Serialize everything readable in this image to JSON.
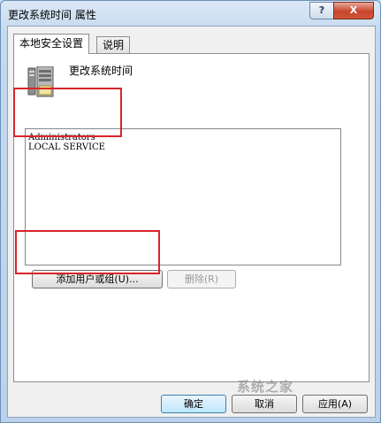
{
  "window": {
    "title": "更改系统时间 属性",
    "help_label": "?",
    "close_label": "X"
  },
  "tabs": [
    {
      "label": "本地安全设置",
      "active": true
    },
    {
      "label": "说明",
      "active": false
    }
  ],
  "policy": {
    "name": "更改系统时间",
    "icon": "server-computer-icon"
  },
  "members": [
    "Administrators",
    "LOCAL SERVICE"
  ],
  "buttons": {
    "add_label": "添加用户或组(U)...",
    "remove_label": "删除(R)",
    "ok_label": "确定",
    "cancel_label": "取消",
    "apply_label": "应用(A)"
  },
  "watermark": "系统之家",
  "colors": {
    "highlight_box": "#d9252a",
    "close_button": "#c8452c"
  }
}
